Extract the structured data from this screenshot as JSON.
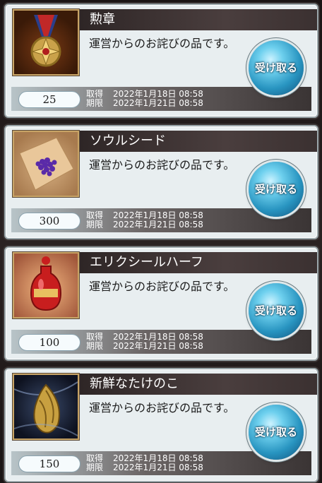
{
  "common": {
    "description": "運営からのお詫びの品です。",
    "obtained_label": "取得",
    "deadline_label": "期限",
    "obtained_date": "2022年1月18日 08:58",
    "deadline_date": "2022年1月21日 08:58",
    "receive_label": "受け取る"
  },
  "items": [
    {
      "name": "勲章",
      "quantity": "25",
      "thumb_icon": "medal-icon"
    },
    {
      "name": "ソウルシード",
      "quantity": "300",
      "thumb_icon": "soul-seed-icon"
    },
    {
      "name": "エリクシールハーフ",
      "quantity": "100",
      "thumb_icon": "elixir-half-icon"
    },
    {
      "name": "新鮮なたけのこ",
      "quantity": "150",
      "thumb_icon": "bamboo-shoot-icon"
    }
  ],
  "colors": {
    "receive_button": "#2894c0",
    "frame_gold": "#c8a466"
  }
}
